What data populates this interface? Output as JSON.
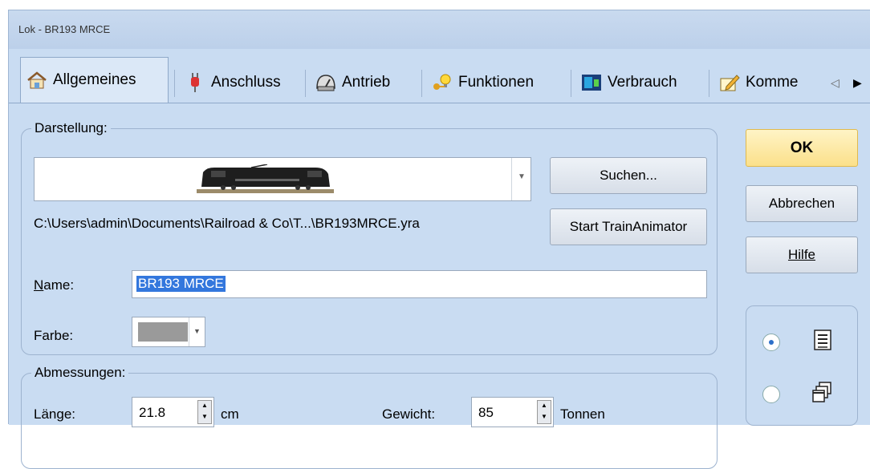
{
  "window": {
    "title": "Lok - BR193 MRCE"
  },
  "tabs": [
    {
      "label": "Allgemeines",
      "icon": "house-settings-icon"
    },
    {
      "label": "Anschluss",
      "icon": "plug-icon"
    },
    {
      "label": "Antrieb",
      "icon": "engine-icon"
    },
    {
      "label": "Funktionen",
      "icon": "bulb-key-icon"
    },
    {
      "label": "Verbrauch",
      "icon": "fuel-icon"
    },
    {
      "label": "Komme",
      "icon": "pencil-note-icon"
    }
  ],
  "darstellung": {
    "legend": "Darstellung:",
    "image_path": "C:\\Users\\admin\\Documents\\Railroad & Co\\T...\\BR193MRCE.yra",
    "search_button": "Suchen...",
    "train_animator_button": "Start TrainAnimator",
    "name_label": "Name:",
    "name_value": "BR193 MRCE",
    "color_label": "Farbe:",
    "color_value": "#9a9a9a"
  },
  "abmessungen": {
    "legend": "Abmessungen:",
    "length_label": "Länge:",
    "length_value": "21.8",
    "length_unit": "cm",
    "weight_label": "Gewicht:",
    "weight_value": "85",
    "weight_unit": "Tonnen"
  },
  "buttons": {
    "ok": "OK",
    "cancel": "Abbrechen",
    "help": "Hilfe"
  },
  "view_options": {
    "selected": "list"
  },
  "colors": {
    "accent_ok": "#fbe08a",
    "selection": "#3377dd"
  }
}
